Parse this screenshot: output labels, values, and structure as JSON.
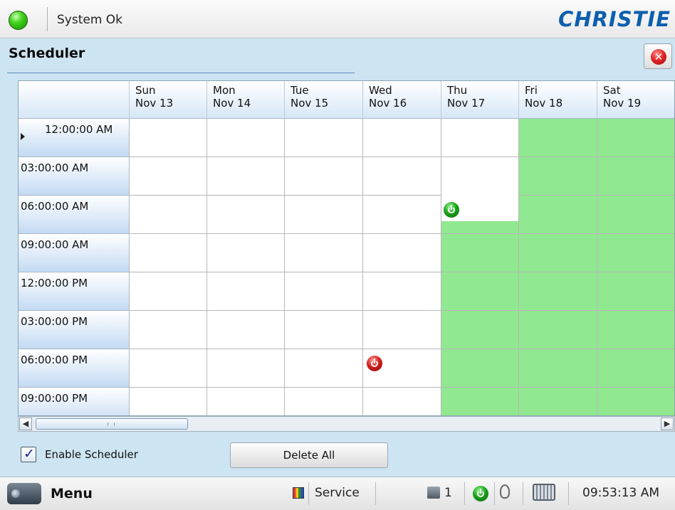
{
  "status": {
    "text": "System Ok"
  },
  "brand": {
    "logo_text": "CHRISTIE"
  },
  "page": {
    "title": "Scheduler"
  },
  "grid": {
    "days": [
      {
        "dow": "Sun",
        "date": "Nov 13"
      },
      {
        "dow": "Mon",
        "date": "Nov 14"
      },
      {
        "dow": "Tue",
        "date": "Nov 15"
      },
      {
        "dow": "Wed",
        "date": "Nov 16"
      },
      {
        "dow": "Thu",
        "date": "Nov 17"
      },
      {
        "dow": "Fri",
        "date": "Nov 18"
      },
      {
        "dow": "Sat",
        "date": "Nov 19"
      }
    ],
    "times": [
      "12:00:00 AM",
      "03:00:00 AM",
      "06:00:00 AM",
      "09:00:00 AM",
      "12:00:00 PM",
      "03:00:00 PM",
      "06:00:00 PM",
      "09:00:00 PM"
    ],
    "events": [
      {
        "day": "Thu Nov 17",
        "time": "06:00:00 AM",
        "action": "power-on"
      },
      {
        "day": "Wed Nov 16",
        "time": "06:00:00 PM",
        "action": "power-off"
      }
    ],
    "colors": {
      "on_period": "#90e890",
      "grid_line": "#c9c9c9"
    }
  },
  "controls": {
    "enable_scheduler_label": "Enable Scheduler",
    "enable_scheduler_checked": true,
    "delete_all_label": "Delete All"
  },
  "bottombar": {
    "menu_label": "Menu",
    "service_label": "Service",
    "channel": "1",
    "clock": "09:53:13 AM"
  }
}
